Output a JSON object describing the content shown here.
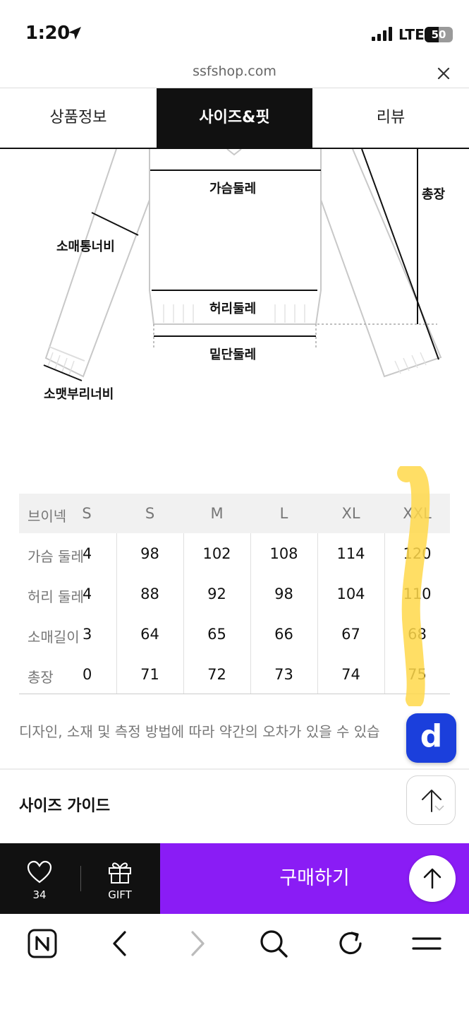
{
  "status_bar": {
    "time": "1:20",
    "network": "LTE",
    "battery": "50",
    "battery_level": 0.5
  },
  "browser": {
    "url": "ssfshop.com"
  },
  "tabs": [
    {
      "label": "상품정보",
      "active": false
    },
    {
      "label": "사이즈&핏",
      "active": true
    },
    {
      "label": "리뷰",
      "active": false
    }
  ],
  "diagram": {
    "chest": "가슴둘레",
    "total_length": "총장",
    "sleeve_width": "소매통너비",
    "waist": "허리둘레",
    "hem": "밑단둘레",
    "cuff_width": "소맷부리너비"
  },
  "size_table": {
    "corner": "브이넥",
    "sizes": [
      "S",
      "S",
      "M",
      "L",
      "XL",
      "XXL"
    ],
    "rows": [
      {
        "label": "가슴 둘레",
        "values": [
          "4",
          "98",
          "102",
          "108",
          "114",
          "120"
        ]
      },
      {
        "label": "허리 둘레",
        "values": [
          "4",
          "88",
          "92",
          "98",
          "104",
          "110"
        ]
      },
      {
        "label": "소매길이",
        "values": [
          "3",
          "64",
          "65",
          "66",
          "67",
          "68"
        ]
      },
      {
        "label": "총장",
        "values": [
          "0",
          "71",
          "72",
          "73",
          "74",
          "75"
        ]
      }
    ]
  },
  "disclaimer": "디자인, 소재 및 측정 방법에 따라 약간의 오차가 있을 수 있습",
  "badge": "d",
  "size_guide": {
    "title": "사이즈 가이드"
  },
  "action_bar": {
    "like_count": "34",
    "gift_label": "GIFT",
    "buy_label": "구매하기"
  },
  "colors": {
    "buy": "#8a1cf5",
    "badge": "#1b3fdc",
    "highlight": "#ffd84a"
  },
  "icons": [
    "location-arrow-icon",
    "signal-icon",
    "battery-icon",
    "close-icon",
    "heart-icon",
    "gift-icon",
    "arrow-up-icon",
    "naver-icon",
    "back-icon",
    "forward-icon",
    "search-icon",
    "refresh-icon",
    "menu-icon"
  ]
}
